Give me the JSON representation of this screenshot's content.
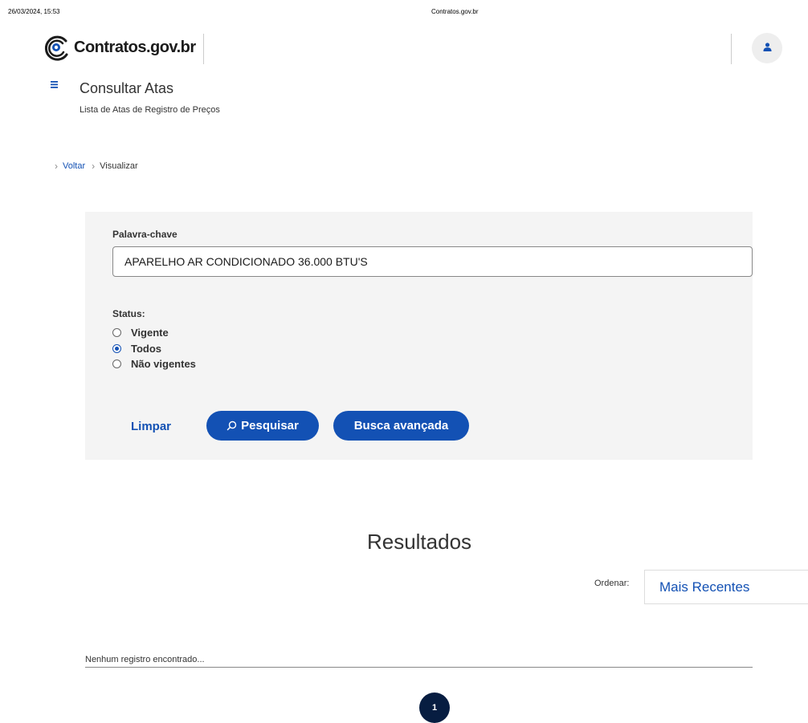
{
  "print_header": {
    "datetime": "26/03/2024, 15:53",
    "site_title": "Contratos.gov.br"
  },
  "header": {
    "logo_text": "Contratos.gov.br",
    "avatar_icon": "user-icon"
  },
  "page": {
    "title": "Consultar Atas",
    "subtitle": "Lista de Atas de Registro de Preços"
  },
  "breadcrumb": {
    "back_label": "Voltar",
    "current_label": "Visualizar"
  },
  "search": {
    "keyword_label": "Palavra-chave",
    "keyword_value": "APARELHO AR CONDICIONADO 36.000 BTU'S",
    "status_label": "Status:",
    "status_options": [
      {
        "label": "Vigente",
        "checked": false
      },
      {
        "label": "Todos",
        "checked": true
      },
      {
        "label": "Não vigentes",
        "checked": false
      }
    ],
    "clear_label": "Limpar",
    "search_label": "Pesquisar",
    "advanced_label": "Busca avançada"
  },
  "results": {
    "title": "Resultados",
    "order_label": "Ordenar:",
    "order_value": "Mais Recentes",
    "empty_message": "Nenhum registro encontrado..."
  },
  "pagination": {
    "current_page": "1"
  },
  "colors": {
    "primary": "#1351b4",
    "dark_blue": "#071d41",
    "panel_bg": "#f4f4f4"
  }
}
